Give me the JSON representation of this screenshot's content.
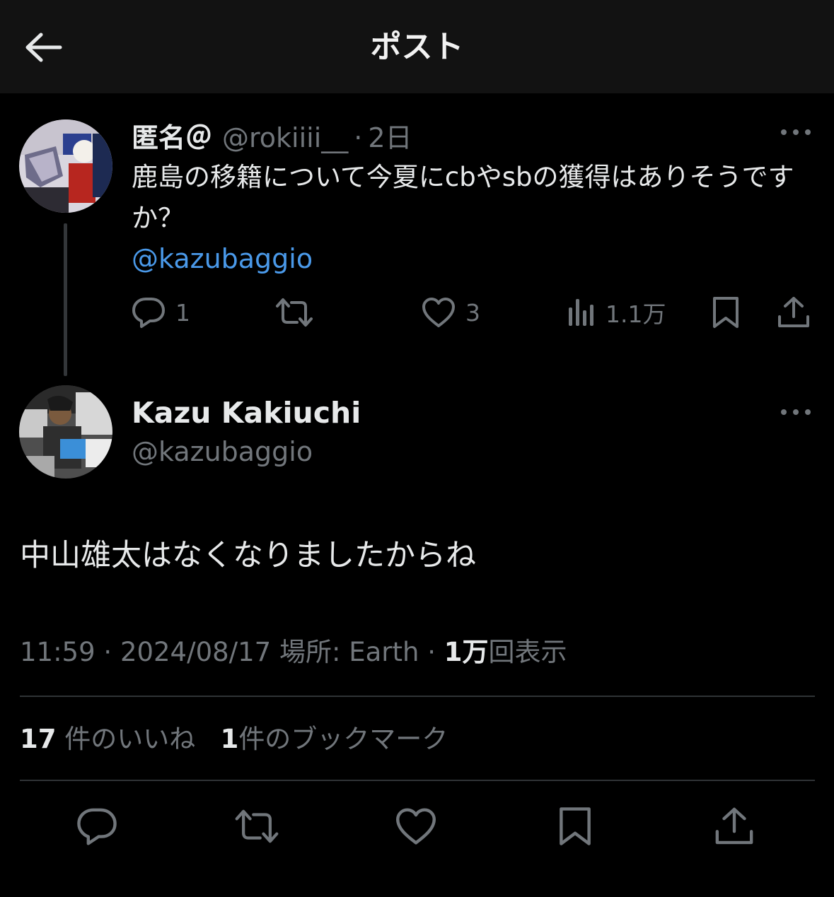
{
  "header": {
    "title": "ポスト",
    "back_icon": "arrow-left-icon"
  },
  "parent_tweet": {
    "display_name": "匿名＠",
    "handle": "@rokiiii__",
    "separator": "·",
    "time": "2日",
    "text": "鹿島の移籍について今夏にcbやsbの獲得はありそうですか？",
    "mention": "@kazubaggio",
    "actions": {
      "reply_count": "1",
      "retweet_count": "",
      "like_count": "3",
      "views_count": "1.1万"
    }
  },
  "main_tweet": {
    "display_name": "Kazu Kakiuchi",
    "handle": "@kazubaggio",
    "text": "中山雄太はなくなりましたからね",
    "time": "11:59",
    "meta_sep": "·",
    "date": "2024/08/17",
    "location": "場所: Earth",
    "views_num": "1万",
    "views_label": "回表示",
    "likes_num": "17",
    "likes_label": "件のいいね",
    "bookmarks_num": "1",
    "bookmarks_label": "件のブックマーク"
  },
  "colors": {
    "background": "#000000",
    "header_bg": "#121212",
    "text": "#e7e9ea",
    "secondary": "#71767b",
    "link": "#4a99e9",
    "divider": "#2f3336"
  }
}
